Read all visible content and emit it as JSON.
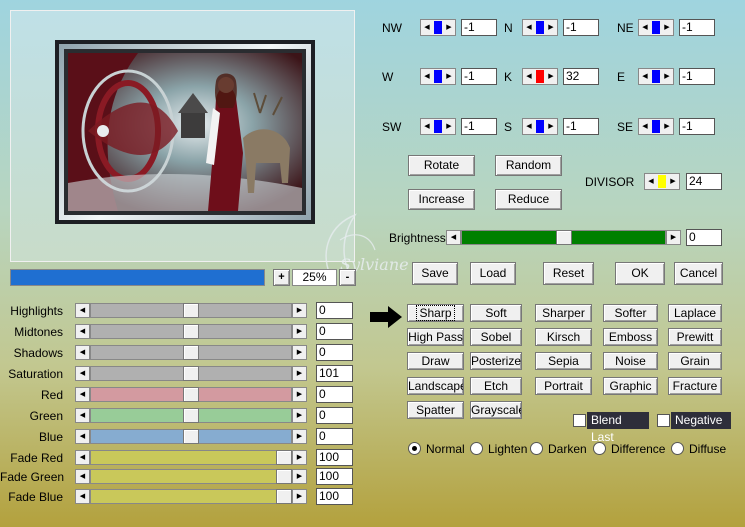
{
  "preview": {
    "zoom": "25%",
    "progress_percent": 100
  },
  "watermark": "Sylviane",
  "directions": [
    {
      "label": "NW",
      "value": "-1",
      "color": "#0000ff"
    },
    {
      "label": "N",
      "value": "-1",
      "color": "#0000ff"
    },
    {
      "label": "NE",
      "value": "-1",
      "color": "#0000ff"
    },
    {
      "label": "W",
      "value": "-1",
      "color": "#0000ff"
    },
    {
      "label": "K",
      "value": "32",
      "color": "#ff0000"
    },
    {
      "label": "E",
      "value": "-1",
      "color": "#0000ff"
    },
    {
      "label": "SW",
      "value": "-1",
      "color": "#0000ff"
    },
    {
      "label": "S",
      "value": "-1",
      "color": "#0000ff"
    },
    {
      "label": "SE",
      "value": "-1",
      "color": "#0000ff"
    }
  ],
  "matrix_buttons": {
    "rotate": "Rotate",
    "random": "Random",
    "increase": "Increase",
    "reduce": "Reduce"
  },
  "divisor": {
    "label": "DIVISOR",
    "value": "24",
    "color": "#ffff00"
  },
  "brightness": {
    "label": "Brightness",
    "value": "0",
    "fill_color": "#008000",
    "position": 0.5
  },
  "actions": {
    "save": "Save",
    "load": "Load",
    "reset": "Reset",
    "ok": "OK",
    "cancel": "Cancel"
  },
  "sliders": [
    {
      "label": "Highlights",
      "value": "0",
      "level": 0.5,
      "color": "#b0b0b0"
    },
    {
      "label": "Midtones",
      "value": "0",
      "level": 0.5,
      "color": "#b0b0b0"
    },
    {
      "label": "Shadows",
      "value": "0",
      "level": 0.5,
      "color": "#b0b0b0"
    },
    {
      "label": "Saturation",
      "value": "101",
      "level": 0.5,
      "color": "#b0b0b0"
    },
    {
      "label": "Red",
      "value": "0",
      "level": 0.5,
      "color": "#d39aa0"
    },
    {
      "label": "Green",
      "value": "0",
      "level": 0.5,
      "color": "#98cc98"
    },
    {
      "label": "Blue",
      "value": "0",
      "level": 0.5,
      "color": "#86acd0"
    },
    {
      "label": "Fade Red",
      "value": "100",
      "level": 1,
      "color": "#c9c85a"
    },
    {
      "label": "Fade Green",
      "value": "100",
      "level": 1,
      "color": "#c9c85a"
    },
    {
      "label": "Fade Blue",
      "value": "100",
      "level": 1,
      "color": "#c9c85a"
    }
  ],
  "presets": [
    [
      "Sharp",
      "Soft",
      "Sharper",
      "Softer",
      "Laplace"
    ],
    [
      "High Pass",
      "Sobel",
      "Kirsch",
      "Emboss",
      "Prewitt"
    ],
    [
      "Draw",
      "Posterize",
      "Sepia",
      "Noise",
      "Grain"
    ],
    [
      "Landscape",
      "Etch",
      "Portrait",
      "Graphic",
      "Fracture"
    ],
    [
      "Spatter",
      "Grayscale"
    ]
  ],
  "selected_preset": "Sharp",
  "checkboxes": {
    "blend_last": "Blend Last",
    "negative": "Negative"
  },
  "modes": [
    "Normal",
    "Lighten",
    "Darken",
    "Difference",
    "Diffuse"
  ],
  "selected_mode": "Normal",
  "zoom_controls": {
    "plus": "+",
    "minus": "-"
  }
}
